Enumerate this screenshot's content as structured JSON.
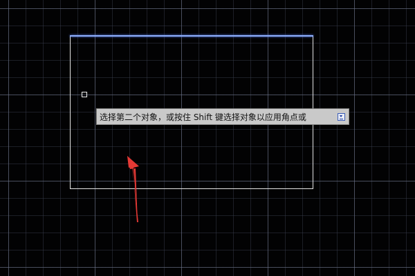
{
  "canvas": {
    "background_color": "#020203",
    "grid_color": "#6e768c"
  },
  "object": {
    "stroke_color": "#e6e6e6",
    "highlight_color": "#8fb0ff"
  },
  "command_prompt": {
    "text": "选择第二个对象，或按住 Shift 键选择对象以应用角点或",
    "options_icon": "dropdown-arrow-icon"
  },
  "annotation": {
    "arrow_color": "#e53935",
    "icon": "red-arrow-icon"
  }
}
